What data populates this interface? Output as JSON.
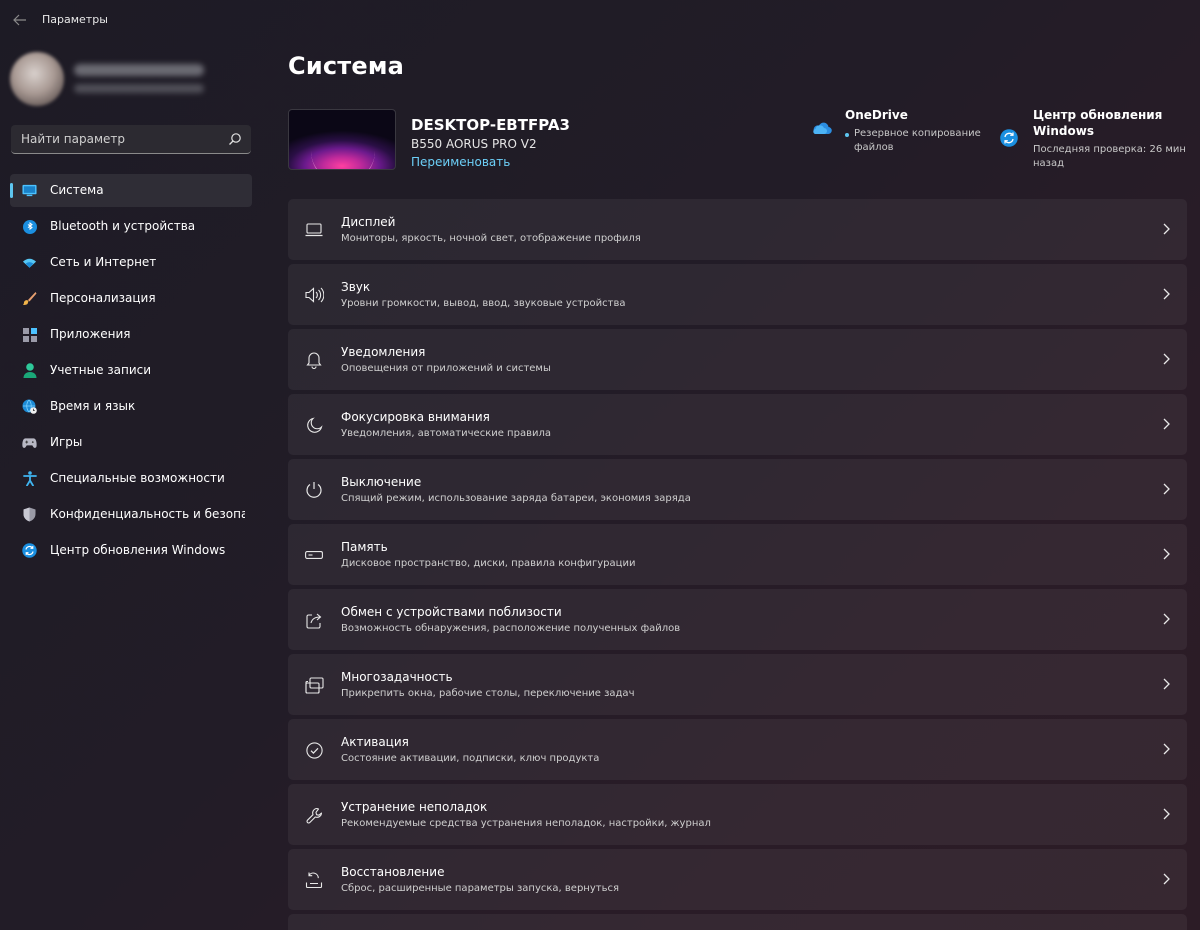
{
  "window": {
    "title": "Параметры"
  },
  "sidebar": {
    "search": {
      "placeholder": "Найти параметр"
    },
    "items": [
      {
        "label": "Система",
        "icon": "monitor-icon",
        "active": true
      },
      {
        "label": "Bluetooth и устройства",
        "icon": "bluetooth-icon"
      },
      {
        "label": "Сеть и Интернет",
        "icon": "wifi-icon"
      },
      {
        "label": "Персонализация",
        "icon": "brush-icon"
      },
      {
        "label": "Приложения",
        "icon": "apps-icon"
      },
      {
        "label": "Учетные записи",
        "icon": "account-icon"
      },
      {
        "label": "Время и язык",
        "icon": "globe-clock-icon"
      },
      {
        "label": "Игры",
        "icon": "gamepad-icon"
      },
      {
        "label": "Специальные возможности",
        "icon": "accessibility-icon"
      },
      {
        "label": "Конфиденциальность и безопас",
        "icon": "shield-icon"
      },
      {
        "label": "Центр обновления Windows",
        "icon": "update-icon"
      }
    ]
  },
  "main": {
    "title": "Система",
    "device": {
      "name": "DESKTOP-EBTFPA3",
      "model": "B550 AORUS PRO V2",
      "rename_label": "Переименовать"
    },
    "quick_actions": {
      "onedrive": {
        "title": "OneDrive",
        "subtitle": "Резервное копирование файлов"
      },
      "update": {
        "title": "Центр обновления Windows",
        "subtitle": "Последняя проверка: 26 мин назад"
      }
    },
    "settings": [
      {
        "title": "Дисплей",
        "desc": "Мониторы, яркость, ночной свет, отображение профиля",
        "icon": "display-icon"
      },
      {
        "title": "Звук",
        "desc": "Уровни громкости, вывод, ввод, звуковые устройства",
        "icon": "speaker-icon"
      },
      {
        "title": "Уведомления",
        "desc": "Оповещения от приложений и системы",
        "icon": "bell-icon"
      },
      {
        "title": "Фокусировка внимания",
        "desc": "Уведомления, автоматические правила",
        "icon": "moon-icon"
      },
      {
        "title": "Выключение",
        "desc": "Спящий режим, использование заряда батареи, экономия заряда",
        "icon": "power-icon"
      },
      {
        "title": "Память",
        "desc": "Дисковое пространство, диски, правила конфигурации",
        "icon": "storage-icon"
      },
      {
        "title": "Обмен с устройствами поблизости",
        "desc": "Возможность обнаружения, расположение полученных файлов",
        "icon": "share-icon"
      },
      {
        "title": "Многозадачность",
        "desc": "Прикрепить окна, рабочие столы, переключение задач",
        "icon": "multitask-icon"
      },
      {
        "title": "Активация",
        "desc": "Состояние активации, подписки, ключ продукта",
        "icon": "check-circle-icon"
      },
      {
        "title": "Устранение неполадок",
        "desc": "Рекомендуемые средства устранения неполадок, настройки, журнал",
        "icon": "wrench-icon"
      },
      {
        "title": "Восстановление",
        "desc": "Сброс, расширенные параметры запуска, вернуться",
        "icon": "recovery-icon"
      }
    ]
  }
}
